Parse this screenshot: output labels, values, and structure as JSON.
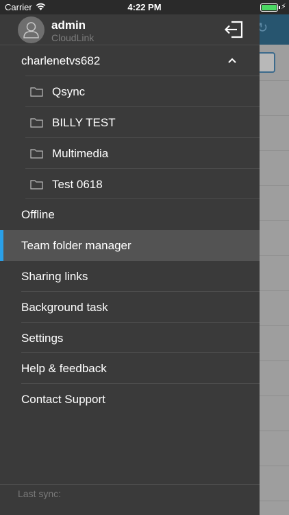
{
  "status_bar": {
    "carrier": "Carrier",
    "time": "4:22 PM",
    "battery_color": "#4cd964",
    "battery_level": 1.0
  },
  "user": {
    "name": "admin",
    "subtitle": "CloudLink",
    "avatar_icon": "user-icon",
    "logout_icon": "logout-icon"
  },
  "server": {
    "name": "charlenetvs682",
    "chevron_icon": "chevron-up-icon",
    "folders": [
      {
        "label": "Qsync",
        "icon": "folder-icon"
      },
      {
        "label": "BILLY TEST",
        "icon": "folder-icon"
      },
      {
        "label": "Multimedia",
        "icon": "folder-icon"
      },
      {
        "label": "Test 0618",
        "icon": "folder-icon"
      }
    ]
  },
  "menu": {
    "items": [
      {
        "label": "Offline",
        "active": false
      },
      {
        "label": "Team folder manager",
        "active": true
      },
      {
        "label": "Sharing links",
        "active": false
      },
      {
        "label": "Background task",
        "active": false
      },
      {
        "label": "Settings",
        "active": false
      },
      {
        "label": "Help & feedback",
        "active": false
      },
      {
        "label": "Contact Support",
        "active": false
      }
    ]
  },
  "footer": {
    "last_sync": "Last sync:"
  },
  "colors": {
    "drawer_bg": "#3a3a3a",
    "active_row_bg": "#535353",
    "accent": "#2aa0e8",
    "app_header": "#27556f"
  }
}
